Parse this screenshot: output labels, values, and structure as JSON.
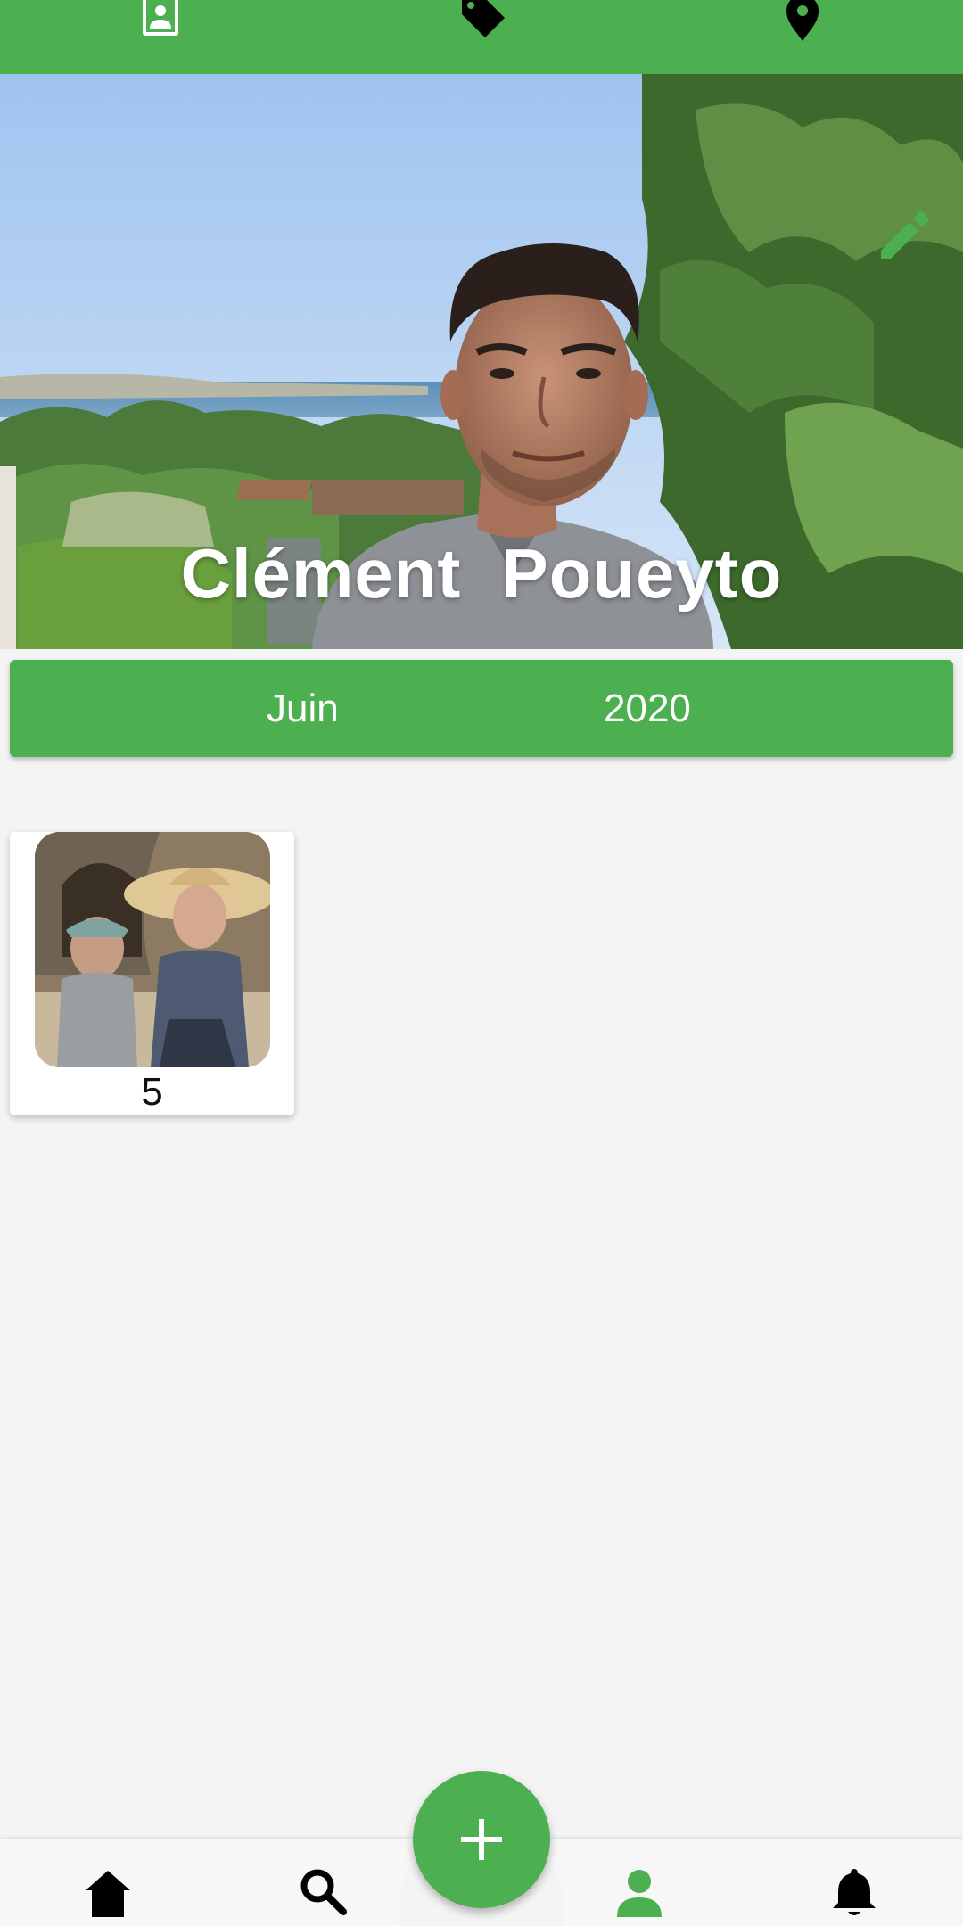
{
  "colors": {
    "primary": "#4caf50",
    "background": "#f4f4f4",
    "card": "#ffffff",
    "nav_inactive": "#000000",
    "nav_active": "#4caf50"
  },
  "top_tabs": [
    {
      "icon": "contact-card-icon",
      "active": true
    },
    {
      "icon": "tag-icon",
      "active": false
    },
    {
      "icon": "location-pin-icon",
      "active": false
    }
  ],
  "profile": {
    "name": "Clément  Poueyto",
    "edit_icon": "pencil-icon"
  },
  "period": {
    "month": "Juin",
    "year": "2020"
  },
  "grid": [
    {
      "count": "5",
      "thumbnail": "photo-two-friends-with-hats"
    }
  ],
  "bottom_nav": {
    "items": [
      {
        "icon": "home-icon",
        "active": false
      },
      {
        "icon": "search-icon",
        "active": false
      },
      {
        "icon": "person-icon",
        "active": true
      },
      {
        "icon": "bell-icon",
        "active": false
      }
    ],
    "fab_icon": "plus-icon"
  }
}
